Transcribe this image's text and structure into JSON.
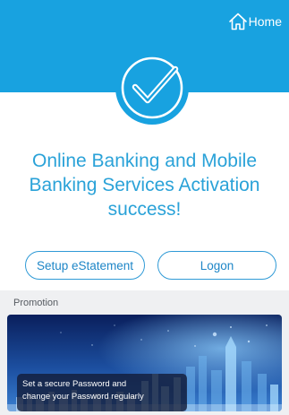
{
  "header": {
    "home_label": "Home",
    "home_icon": "home-icon",
    "background_color": "#18a2e0"
  },
  "status": {
    "icon": "check-circle-icon",
    "lines": [
      "Online Banking and Mobile",
      "Banking Services Activation",
      "success!"
    ],
    "color": "#2aa2d8"
  },
  "actions": {
    "setup_estatement_label": "Setup eStatement",
    "logon_label": "Logon"
  },
  "promotion": {
    "section_label": "Promotion",
    "banner_lines": [
      "Set a secure Password and",
      "change your Password regularly"
    ]
  }
}
